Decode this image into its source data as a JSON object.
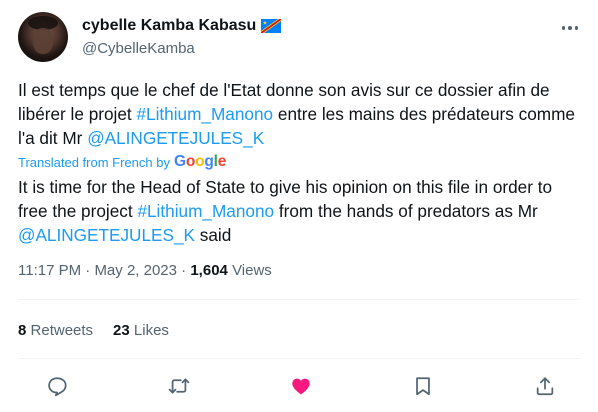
{
  "author": {
    "display_name": "cybelle Kamba Kabasu",
    "handle": "@CybelleKamba",
    "flag_icon": "drc-flag-icon",
    "avatar": "profile-photo"
  },
  "tweet": {
    "original_parts": [
      "Il est temps que le chef de l'Etat donne son avis sur ce dossier afin de libérer le projet ",
      "#Lithium_Manono",
      " entre les mains des prédateurs comme l'a dit Mr ",
      "@ALINGETEJULES_K"
    ],
    "translated_from": "Translated from French by",
    "translator": "Google",
    "translation_parts": [
      "It is time for the Head of State to give his opinion on this file in order to free the project ",
      "#Lithium_Manono",
      " from the hands of predators as Mr ",
      "@ALINGETEJULES_K",
      " said"
    ]
  },
  "meta": {
    "time": "11:17 PM",
    "separator": "·",
    "date": "May 2, 2023",
    "views_count": "1,604",
    "views_label": "Views"
  },
  "stats": {
    "retweets_count": "8",
    "retweets_label": "Retweets",
    "likes_count": "23",
    "likes_label": "Likes"
  },
  "actions": [
    "reply-icon",
    "retweet-icon",
    "like-icon",
    "bookmark-icon",
    "share-icon"
  ],
  "colors": {
    "text": "#0f1419",
    "secondary": "#536471",
    "link": "#1d9bf0",
    "like_active": "#f91880",
    "divider": "#eff3f4",
    "google_blue": "#4285f4",
    "google_red": "#ea4335",
    "google_yellow": "#fbbc05",
    "google_green": "#34a853"
  }
}
